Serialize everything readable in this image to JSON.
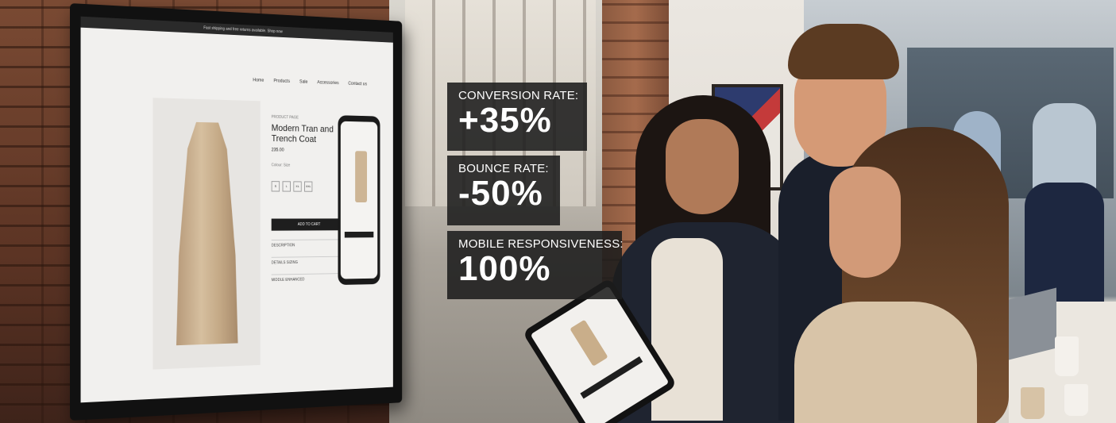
{
  "monitor_screen": {
    "topbar_text": "Fast shipping and free returns available. Shop now",
    "nav_items": [
      "Home",
      "Products",
      "Sale",
      "Accessories",
      "Contact us"
    ],
    "breadcrumb": "PRODUCT PAGE",
    "product_title": "Modern Tran and Trench Coat",
    "price": "235.00",
    "size_label": "Colour: Size",
    "sizes": [
      "S",
      "L",
      "XL",
      "XXL"
    ],
    "add_to_cart": "ADD TO CART",
    "accordion": [
      "DESCRIPTION",
      "DETAILS SIZING",
      "MIDDLE ENHANCED"
    ]
  },
  "stats": [
    {
      "label": "CONVERSION RATE:",
      "value": "+35%"
    },
    {
      "label": "BOUNCE RATE:",
      "value": "-50%"
    },
    {
      "label": "MOBILE RESPONSIVENESS:",
      "value": "100%"
    }
  ],
  "colors": {
    "overlay_bg": "#1c1c1c",
    "overlay_text": "#ffffff",
    "coat": "#d6bf9f"
  }
}
